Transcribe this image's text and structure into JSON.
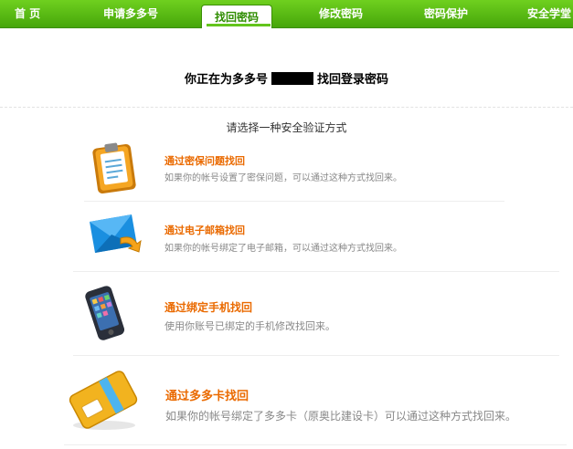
{
  "nav": {
    "items": [
      {
        "label": "首 页"
      },
      {
        "label": "申请多多号"
      },
      {
        "label": "找回密码",
        "active": true
      },
      {
        "label": "修改密码"
      },
      {
        "label": "密码保护"
      },
      {
        "label": "安全学堂"
      }
    ]
  },
  "headline": {
    "prefix": "你正在为多多号",
    "suffix": "找回登录密码"
  },
  "subhead": "请选择一种安全验证方式",
  "options": [
    {
      "title": "通过密保问题找回",
      "desc": "如果你的帐号设置了密保问题，可以通过这种方式找回来。",
      "icon": "clipboard-icon"
    },
    {
      "title": "通过电子邮箱找回",
      "desc": "如果你的帐号绑定了电子邮箱，可以通过这种方式找回来。",
      "icon": "email-envelope-icon"
    },
    {
      "title": "通过绑定手机找回",
      "desc": "使用你账号已绑定的手机修改找回来。",
      "icon": "mobile-phone-icon"
    },
    {
      "title": "通过多多卡找回",
      "desc": "如果你的帐号绑定了多多卡（原奥比建设卡）可以通过这种方式找回来。",
      "icon": "card-icon"
    }
  ],
  "colors": {
    "nav_green": "#46a60a",
    "title_orange": "#ea6a00",
    "desc_gray": "#888888"
  }
}
